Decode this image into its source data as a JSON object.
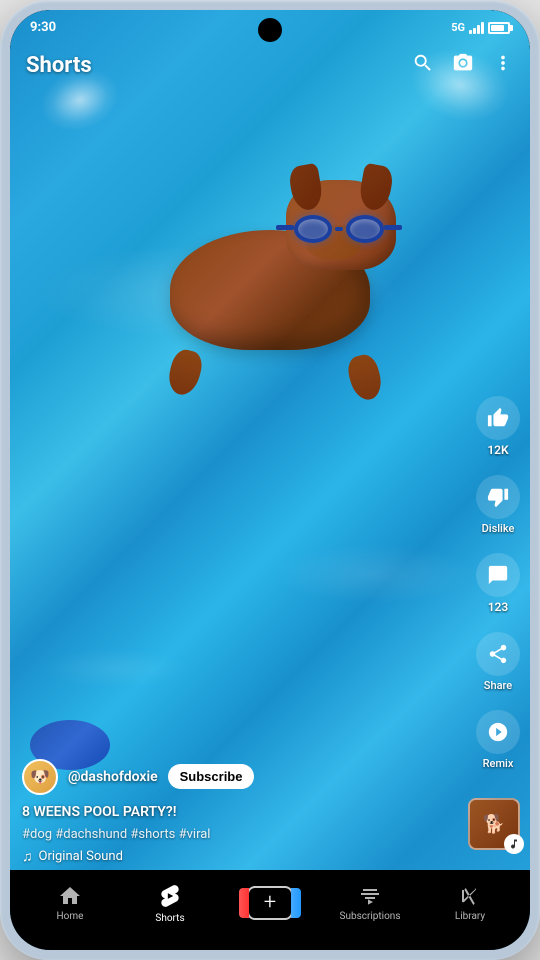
{
  "statusBar": {
    "time": "9:30",
    "network": "5G"
  },
  "topBar": {
    "title": "Shorts",
    "searchIcon": "search",
    "cameraIcon": "camera",
    "moreIcon": "more-vertical"
  },
  "video": {
    "channelHandle": "@dashofdoxie",
    "subscribeLabel": "Subscribe",
    "title": "8 WEENS POOL PARTY?!",
    "hashtags": "#dog #dachshund #shorts #viral",
    "music": "Original Sound"
  },
  "actions": {
    "likeCount": "12K",
    "likeLabel": "Like",
    "dislikeLabel": "Dislike",
    "commentCount": "123",
    "commentLabel": "Comments",
    "shareLabel": "Share",
    "remixLabel": "Remix"
  },
  "bottomNav": {
    "items": [
      {
        "id": "home",
        "label": "Home",
        "active": false
      },
      {
        "id": "shorts",
        "label": "Shorts",
        "active": true
      },
      {
        "id": "create",
        "label": "",
        "active": false
      },
      {
        "id": "subscriptions",
        "label": "Subscriptions",
        "active": false
      },
      {
        "id": "library",
        "label": "Library",
        "active": false
      }
    ]
  },
  "colors": {
    "accent": "#ff0000",
    "navBg": "#000000",
    "activeIcon": "#ffffff",
    "inactiveIcon": "rgba(255,255,255,0.7)"
  }
}
